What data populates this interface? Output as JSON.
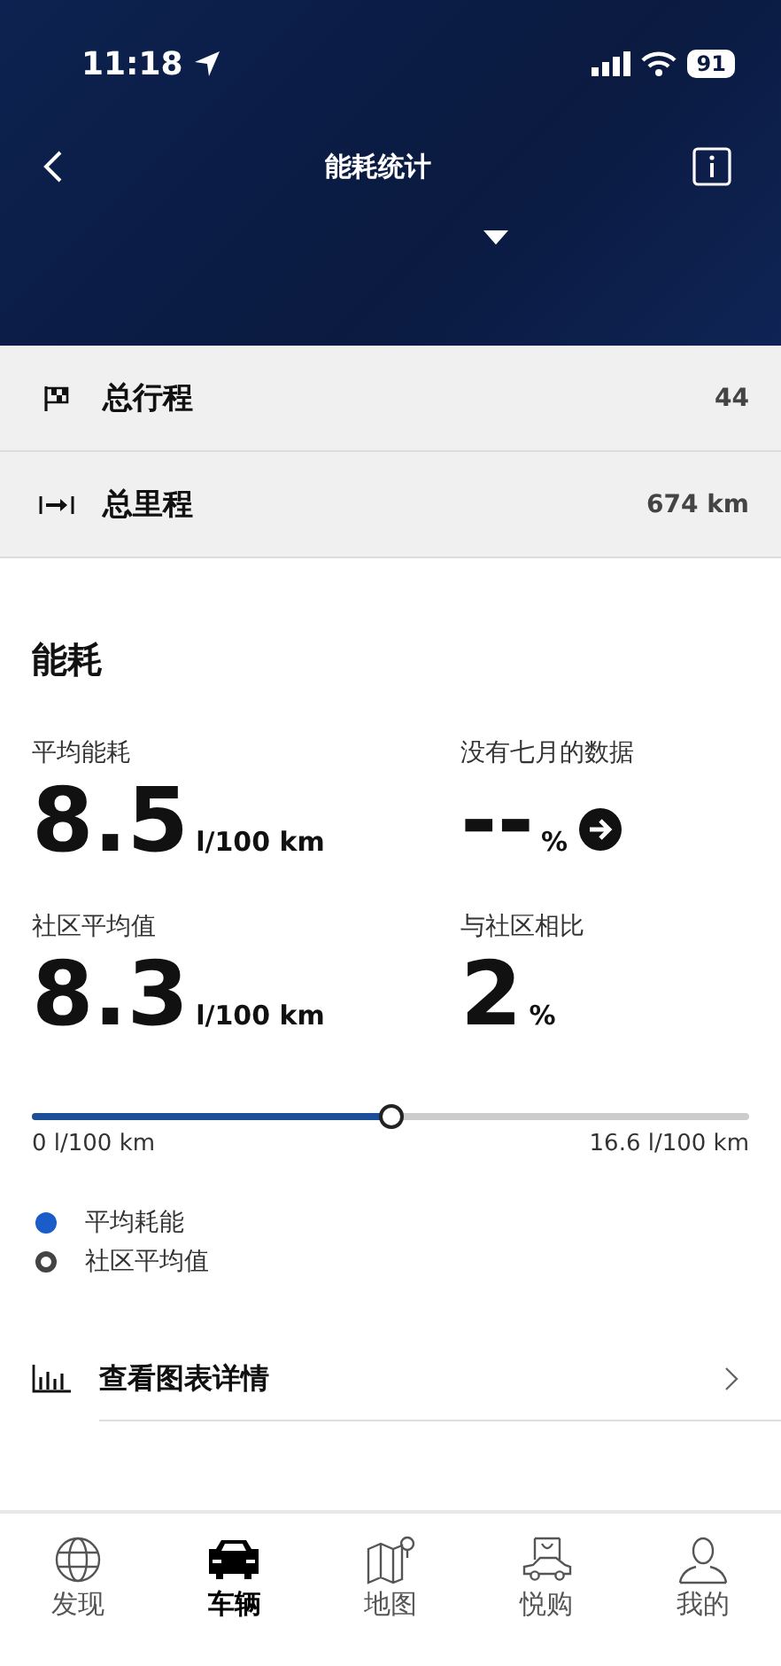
{
  "status_bar": {
    "time": "11:18",
    "battery": "91"
  },
  "nav": {
    "title": "能耗统计"
  },
  "summary_rows": [
    {
      "kind": "trips",
      "label": "总行程",
      "value": "44"
    },
    {
      "kind": "distance",
      "label": "总里程",
      "value": "674 km"
    }
  ],
  "section_title": "能耗",
  "stats": [
    {
      "label": "平均能耗",
      "value": "8.5",
      "unit": "l/100 km",
      "kind": "plain"
    },
    {
      "label": "没有七月的数据",
      "value": "--",
      "unit": "%",
      "kind": "link"
    },
    {
      "label": "社区平均值",
      "value": "8.3",
      "unit": "l/100 km",
      "kind": "plain"
    },
    {
      "label": "与社区相比",
      "value": "2",
      "unit": "%",
      "kind": "plain"
    }
  ],
  "slider": {
    "level": 0.5,
    "min_label": "0 l/100 km",
    "max_label": "16.6 l/100 km"
  },
  "legend": [
    {
      "label": "平均耗能",
      "kind": "filled",
      "color": "#1a5cc8"
    },
    {
      "label": "社区平均值",
      "kind": "ring",
      "color": "#444444"
    }
  ],
  "chart_link": {
    "label": "查看图表详情"
  },
  "tabs": [
    {
      "label": "发现",
      "kind": "globe",
      "selected": false
    },
    {
      "label": "车辆",
      "kind": "car",
      "selected": true
    },
    {
      "label": "地图",
      "kind": "map",
      "selected": false
    },
    {
      "label": "悦购",
      "kind": "shop",
      "selected": false
    },
    {
      "label": "我的",
      "kind": "person",
      "selected": false
    }
  ]
}
